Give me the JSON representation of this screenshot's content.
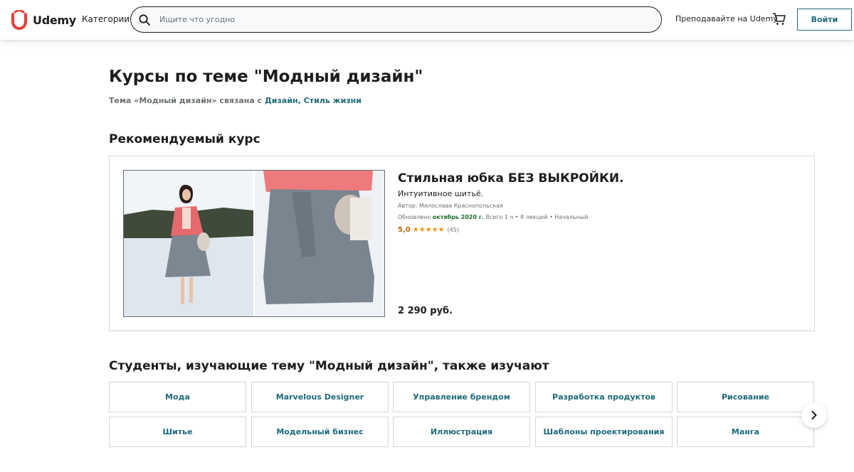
{
  "header": {
    "logo_text": "Udemy",
    "categories_label": "Категории",
    "search_placeholder": "Ищите что угодно",
    "teach_label": "Преподавайте на Udemy",
    "login_label": "Войти"
  },
  "main": {
    "title": "Курсы по теме \"Модный дизайн\"",
    "topic_prefix": "Тема «Модный дизайн» связана с ",
    "topic_links": "Дизайн, Стиль жизни",
    "featured_heading": "Рекомендуемый курс",
    "featured_course": {
      "title": "Стильная юбка БЕЗ ВЫКРОЙКИ.",
      "subtitle": "Интуитивное шитьё.",
      "author": "Автор: Милослава Краснопольская",
      "updated_prefix": "Обновлено ",
      "updated_date": "октябрь 2020 г.",
      "details": "  Всего 1 ч • 8 лекций • Начальный",
      "rating": "5,0",
      "stars": "★★★★★",
      "rating_count": "(45)",
      "price": "2 290 руб."
    },
    "related_heading": "Студенты, изучающие тему \"Модный дизайн\", также изучают",
    "related_topics": [
      "Мода",
      "Marvelous Designer",
      "Управление брендом",
      "Разработка продуктов",
      "Рисование",
      "Шитье",
      "Модельный бизнес",
      "Иллюстрация",
      "Шаблоны проектирования",
      "Манга"
    ]
  },
  "colors": {
    "brand": "#a435f0",
    "link": "#1e6a7b",
    "rating": "#b4690e",
    "star": "#e59819",
    "updated": "#1e6a2b"
  }
}
